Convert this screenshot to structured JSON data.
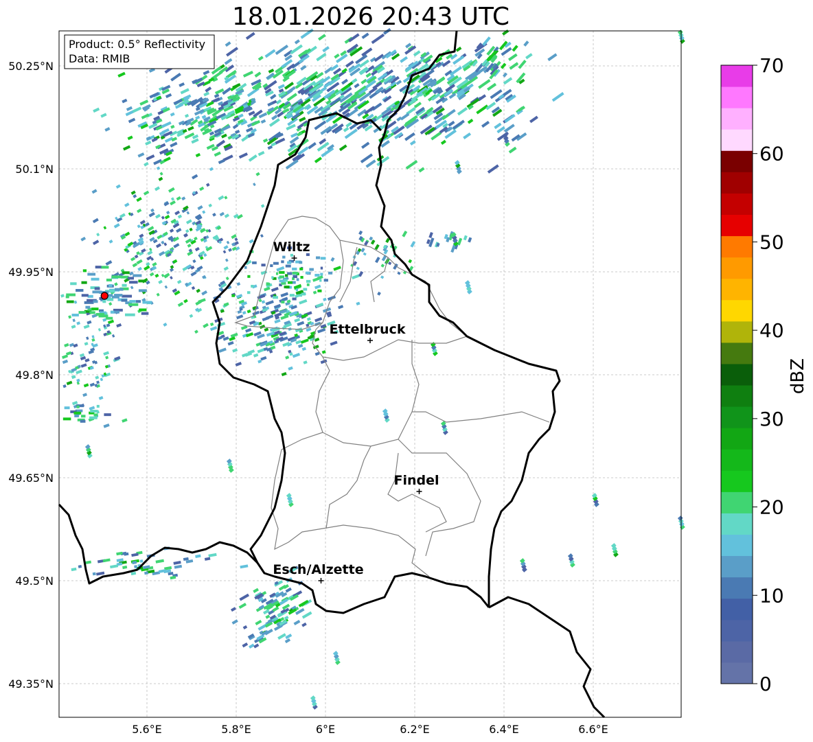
{
  "title": "18.01.2026 20:43 UTC",
  "info": {
    "product": "Product: 0.5° Reflectivity",
    "data": "Data: RMIB"
  },
  "lat_ticks": [
    "50.25°N",
    "50.1°N",
    "49.95°N",
    "49.8°N",
    "49.65°N",
    "49.5°N",
    "49.35°N"
  ],
  "lon_ticks": [
    "5.6°E",
    "5.8°E",
    "6°E",
    "6.2°E",
    "6.4°E",
    "6.6°E"
  ],
  "cities": [
    {
      "name": "Wiltz",
      "lat": 49.97,
      "lon": 5.93
    },
    {
      "name": "Ettelbruck",
      "lat": 49.85,
      "lon": 6.1
    },
    {
      "name": "Findel",
      "lat": 49.63,
      "lon": 6.21
    },
    {
      "name": "Esch/Alzette",
      "lat": 49.5,
      "lon": 5.99
    }
  ],
  "radar_site": {
    "lat": 49.915,
    "lon": 5.505,
    "color": "#ff0000"
  },
  "colorbar": {
    "label": "dBZ",
    "ticks": [
      "0",
      "10",
      "20",
      "30",
      "40",
      "50",
      "60",
      "70"
    ],
    "colors": [
      "#6473a8",
      "#5a6aa5",
      "#4d64a6",
      "#4260a6",
      "#4a7ab3",
      "#5a9ec8",
      "#62c1dc",
      "#62d8c6",
      "#40d572",
      "#16c81e",
      "#14b81a",
      "#12a714",
      "#10941a",
      "#0f7f10",
      "#0a5e0a",
      "#457a0f",
      "#b0b40a",
      "#ffd700",
      "#ffb400",
      "#ff9a00",
      "#ff7a00",
      "#e60000",
      "#c40000",
      "#a00000",
      "#7a0000",
      "#ffd9ff",
      "#ffb0ff",
      "#ff78ff",
      "#e83ce8"
    ]
  }
}
